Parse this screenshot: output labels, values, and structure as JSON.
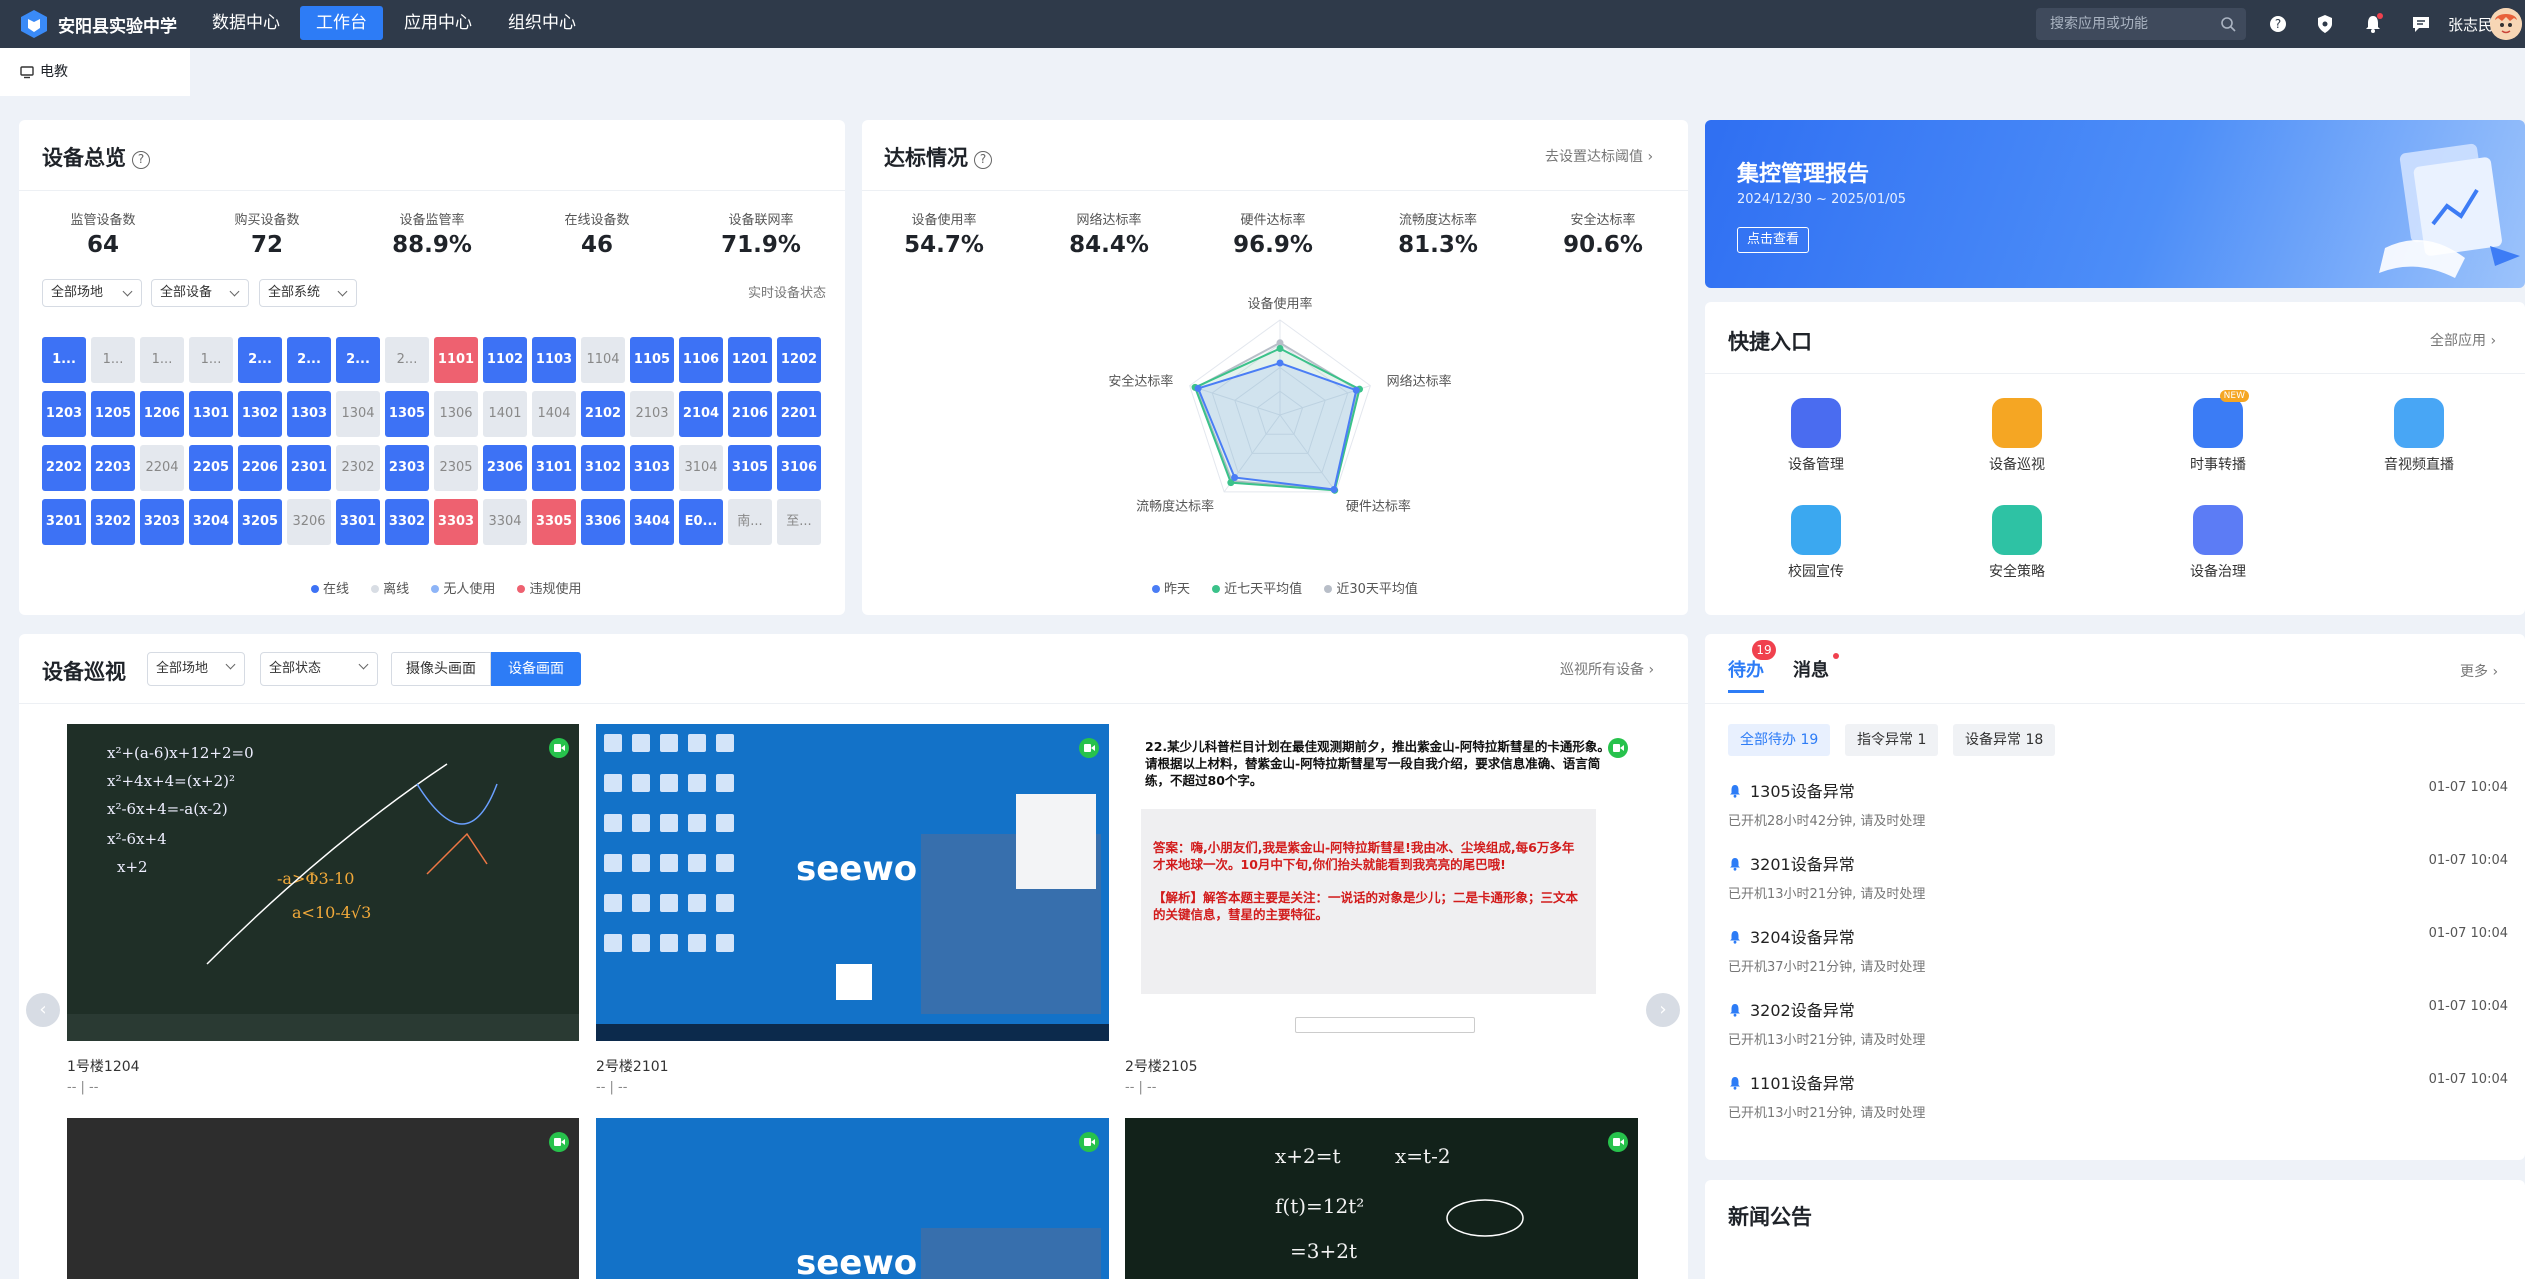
{
  "header": {
    "school": "安阳县实验中学",
    "nav": [
      "数据中心",
      "工作台",
      "应用中心",
      "组织中心"
    ],
    "active_nav": "工作台",
    "search_placeholder": "搜索应用或功能",
    "user": "张志民"
  },
  "tab": {
    "label": "电教"
  },
  "overview": {
    "title": "设备总览",
    "stats": [
      {
        "label": "监管设备数",
        "value": "64"
      },
      {
        "label": "购买设备数",
        "value": "72"
      },
      {
        "label": "设备监管率",
        "value": "88.9%"
      },
      {
        "label": "在线设备数",
        "value": "46"
      },
      {
        "label": "设备联网率",
        "value": "71.9%"
      }
    ],
    "filters": [
      "全部场地",
      "全部设备",
      "全部系统"
    ],
    "realtime": "实时设备状态",
    "devices": [
      {
        "n": "1...",
        "s": "on"
      },
      {
        "n": "1...",
        "s": "off"
      },
      {
        "n": "1...",
        "s": "off"
      },
      {
        "n": "1...",
        "s": "off"
      },
      {
        "n": "2...",
        "s": "on"
      },
      {
        "n": "2...",
        "s": "on"
      },
      {
        "n": "2...",
        "s": "on"
      },
      {
        "n": "2...",
        "s": "off"
      },
      {
        "n": "1101",
        "s": "bad"
      },
      {
        "n": "1102",
        "s": "on"
      },
      {
        "n": "1103",
        "s": "on"
      },
      {
        "n": "1104",
        "s": "off"
      },
      {
        "n": "1105",
        "s": "on"
      },
      {
        "n": "1106",
        "s": "on"
      },
      {
        "n": "1201",
        "s": "on"
      },
      {
        "n": "1202",
        "s": "on"
      },
      {
        "n": "1203",
        "s": "on"
      },
      {
        "n": "1205",
        "s": "on"
      },
      {
        "n": "1206",
        "s": "on"
      },
      {
        "n": "1301",
        "s": "on"
      },
      {
        "n": "1302",
        "s": "on"
      },
      {
        "n": "1303",
        "s": "on"
      },
      {
        "n": "1304",
        "s": "off"
      },
      {
        "n": "1305",
        "s": "on"
      },
      {
        "n": "1306",
        "s": "off"
      },
      {
        "n": "1401",
        "s": "off"
      },
      {
        "n": "1404",
        "s": "off"
      },
      {
        "n": "2102",
        "s": "on"
      },
      {
        "n": "2103",
        "s": "off"
      },
      {
        "n": "2104",
        "s": "on"
      },
      {
        "n": "2106",
        "s": "on"
      },
      {
        "n": "2201",
        "s": "on"
      },
      {
        "n": "2202",
        "s": "on"
      },
      {
        "n": "2203",
        "s": "on"
      },
      {
        "n": "2204",
        "s": "off"
      },
      {
        "n": "2205",
        "s": "on"
      },
      {
        "n": "2206",
        "s": "on"
      },
      {
        "n": "2301",
        "s": "on"
      },
      {
        "n": "2302",
        "s": "off"
      },
      {
        "n": "2303",
        "s": "on"
      },
      {
        "n": "2305",
        "s": "off"
      },
      {
        "n": "2306",
        "s": "on"
      },
      {
        "n": "3101",
        "s": "on"
      },
      {
        "n": "3102",
        "s": "on"
      },
      {
        "n": "3103",
        "s": "on"
      },
      {
        "n": "3104",
        "s": "off"
      },
      {
        "n": "3105",
        "s": "on"
      },
      {
        "n": "3106",
        "s": "on"
      },
      {
        "n": "3201",
        "s": "on"
      },
      {
        "n": "3202",
        "s": "on"
      },
      {
        "n": "3203",
        "s": "on"
      },
      {
        "n": "3204",
        "s": "on"
      },
      {
        "n": "3205",
        "s": "on"
      },
      {
        "n": "3206",
        "s": "off"
      },
      {
        "n": "3301",
        "s": "on"
      },
      {
        "n": "3302",
        "s": "on"
      },
      {
        "n": "3303",
        "s": "bad"
      },
      {
        "n": "3304",
        "s": "off"
      },
      {
        "n": "3305",
        "s": "bad"
      },
      {
        "n": "3306",
        "s": "on"
      },
      {
        "n": "3404",
        "s": "on"
      },
      {
        "n": "E0...",
        "s": "on"
      },
      {
        "n": "南...",
        "s": "off"
      },
      {
        "n": "至...",
        "s": "off"
      }
    ],
    "legend": [
      {
        "label": "在线",
        "color": "#3d72f5"
      },
      {
        "label": "离线",
        "color": "#d8dde4"
      },
      {
        "label": "无人使用",
        "color": "#8db4f7"
      },
      {
        "label": "违规使用",
        "color": "#ee6170"
      }
    ]
  },
  "compliance": {
    "title": "达标情况",
    "link": "去设置达标阈值",
    "stats": [
      {
        "label": "设备使用率",
        "value": "54.7%"
      },
      {
        "label": "网络达标率",
        "value": "84.4%"
      },
      {
        "label": "硬件达标率",
        "value": "96.9%"
      },
      {
        "label": "流畅度达标率",
        "value": "81.3%"
      },
      {
        "label": "安全达标率",
        "value": "90.6%"
      }
    ],
    "legend": [
      {
        "label": "昨天",
        "color": "#4a7df5"
      },
      {
        "label": "近七天平均值",
        "color": "#3bc28a"
      },
      {
        "label": "近30天平均值",
        "color": "#b8bec8"
      }
    ]
  },
  "chart_data": {
    "type": "radar",
    "axes": [
      "设备使用率",
      "网络达标率",
      "硬件达标率",
      "流畅度达标率",
      "安全达标率"
    ],
    "max": 100,
    "series": [
      {
        "name": "昨天",
        "color": "#4a7df5",
        "values": [
          54.7,
          84.4,
          96.9,
          81.3,
          90.6
        ]
      },
      {
        "name": "近七天平均值",
        "color": "#3bc28a",
        "values": [
          70,
          88,
          98,
          88,
          94
        ]
      },
      {
        "name": "近30天平均值",
        "color": "#b8bec8",
        "values": [
          76,
          86,
          97,
          86,
          93
        ]
      }
    ]
  },
  "report": {
    "title": "集控管理报告",
    "date": "2024/12/30 ~ 2025/01/05",
    "button": "点击查看"
  },
  "quick": {
    "title": "快捷入口",
    "link": "全部应用",
    "items": [
      {
        "label": "设备管理",
        "color": "#4a6cf0"
      },
      {
        "label": "设备巡视",
        "color": "#f5a623"
      },
      {
        "label": "时事转播",
        "color": "#3b7cf5"
      },
      {
        "label": "音视频直播",
        "color": "#48a6f5"
      },
      {
        "label": "校园宣传",
        "color": "#3ba8f0"
      },
      {
        "label": "安全策略",
        "color": "#2ec2a4"
      },
      {
        "label": "设备治理",
        "color": "#5c7cf5"
      }
    ],
    "new_badge": "NEW"
  },
  "patrol": {
    "title": "设备巡视",
    "filters": [
      "全部场地",
      "全部状态"
    ],
    "toggle": [
      "摄像头画面",
      "设备画面"
    ],
    "link": "巡视所有设备",
    "screens": [
      {
        "name": "1号楼1204",
        "sub": "-- | --"
      },
      {
        "name": "2号楼2101",
        "sub": "-- | --"
      },
      {
        "name": "2号楼2105",
        "sub": "-- | --"
      }
    ],
    "brand": "seewo",
    "quiz": {
      "question": "22.某少儿科普栏目计划在最佳观测期前夕，推出紫金山-阿特拉斯彗星的卡通形象。请根据以上材料，替紫金山-阿特拉斯彗星写一段自我介绍，要求信息准确、语言简练，不超过80个字。",
      "answer": "答案：嗨,小朋友们,我是紫金山-阿特拉斯彗星!我由冰、尘埃组成,每6万多年才来地球一次。10月中下旬,你们抬头就能看到我亮亮的尾巴哦!",
      "analysis": "【解析】解答本题主要是关注：一说话的对象是少儿；二是卡通形象；三文本的关键信息，彗星的主要特征。"
    },
    "math1": [
      "x²+(a-6)x+12+2=0",
      "x²+4x+4=(x+2)²",
      "x²-6x+4=-a(x-2)",
      "x²-6x+4",
      "x+2",
      "-a>Φ3-10",
      "a<10-4√3"
    ],
    "math2": [
      "x+2=t",
      "x=t-2",
      "f(t)=12t²",
      "=3+2t"
    ]
  },
  "todo": {
    "tab1": "待办",
    "tab2": "消息",
    "badge": "19",
    "more": "更多",
    "chips": [
      "全部待办 19",
      "指令异常 1",
      "设备异常 18"
    ],
    "items": [
      {
        "title": "1305设备异常",
        "time": "01-07 10:04",
        "sub": "已开机28小时42分钟, 请及时处理"
      },
      {
        "title": "3201设备异常",
        "time": "01-07 10:04",
        "sub": "已开机13小时21分钟, 请及时处理"
      },
      {
        "title": "3204设备异常",
        "time": "01-07 10:04",
        "sub": "已开机37小时21分钟, 请及时处理"
      },
      {
        "title": "3202设备异常",
        "time": "01-07 10:04",
        "sub": "已开机13小时21分钟, 请及时处理"
      },
      {
        "title": "1101设备异常",
        "time": "01-07 10:04",
        "sub": "已开机13小时21分钟, 请及时处理"
      }
    ]
  },
  "news": {
    "title": "新闻公告"
  }
}
